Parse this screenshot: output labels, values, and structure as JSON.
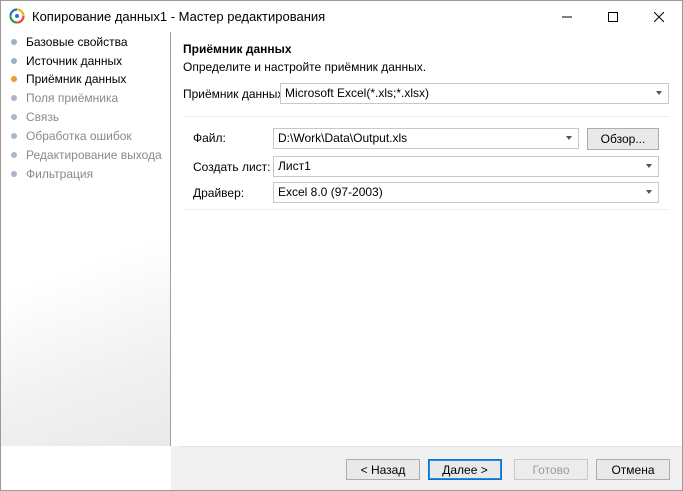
{
  "window": {
    "title": "Копирование данных1 - Мастер редактирования",
    "icons": {
      "app": "app-logo-icon",
      "minimize": "minimize-icon",
      "maximize": "maximize-icon",
      "close": "close-icon"
    }
  },
  "steps": [
    {
      "label": "Базовые свойства",
      "state": "done"
    },
    {
      "label": "Источник данных",
      "state": "done"
    },
    {
      "label": "Приёмник данных",
      "state": "current"
    },
    {
      "label": "Поля приёмника",
      "state": "todo"
    },
    {
      "label": "Связь",
      "state": "todo"
    },
    {
      "label": "Обработка ошибок",
      "state": "todo"
    },
    {
      "label": "Редактирование выхода",
      "state": "todo"
    },
    {
      "label": "Фильтрация",
      "state": "todo"
    }
  ],
  "main": {
    "title": "Приёмник данных",
    "description": "Определите и настройте приёмник данных.",
    "receiver": {
      "label": "Приёмник данных:",
      "value": "Microsoft Excel(*.xls;*.xlsx)"
    },
    "file": {
      "label": "Файл:",
      "value": "D:\\Work\\Data\\Output.xls",
      "browse_label": "Обзор..."
    },
    "sheet": {
      "label": "Создать лист:",
      "value": "Лист1"
    },
    "driver": {
      "label": "Драйвер:",
      "value": "Excel 8.0 (97-2003)"
    }
  },
  "footer": {
    "back_label": "< Назад",
    "next_label": "Далее >",
    "finish_label": "Готово",
    "cancel_label": "Отмена"
  },
  "colors": {
    "current_step": "#f29a2e",
    "done_step": "#9ab0c4",
    "todo_step": "#a8b8c8",
    "focus_border": "#0b74d0"
  }
}
